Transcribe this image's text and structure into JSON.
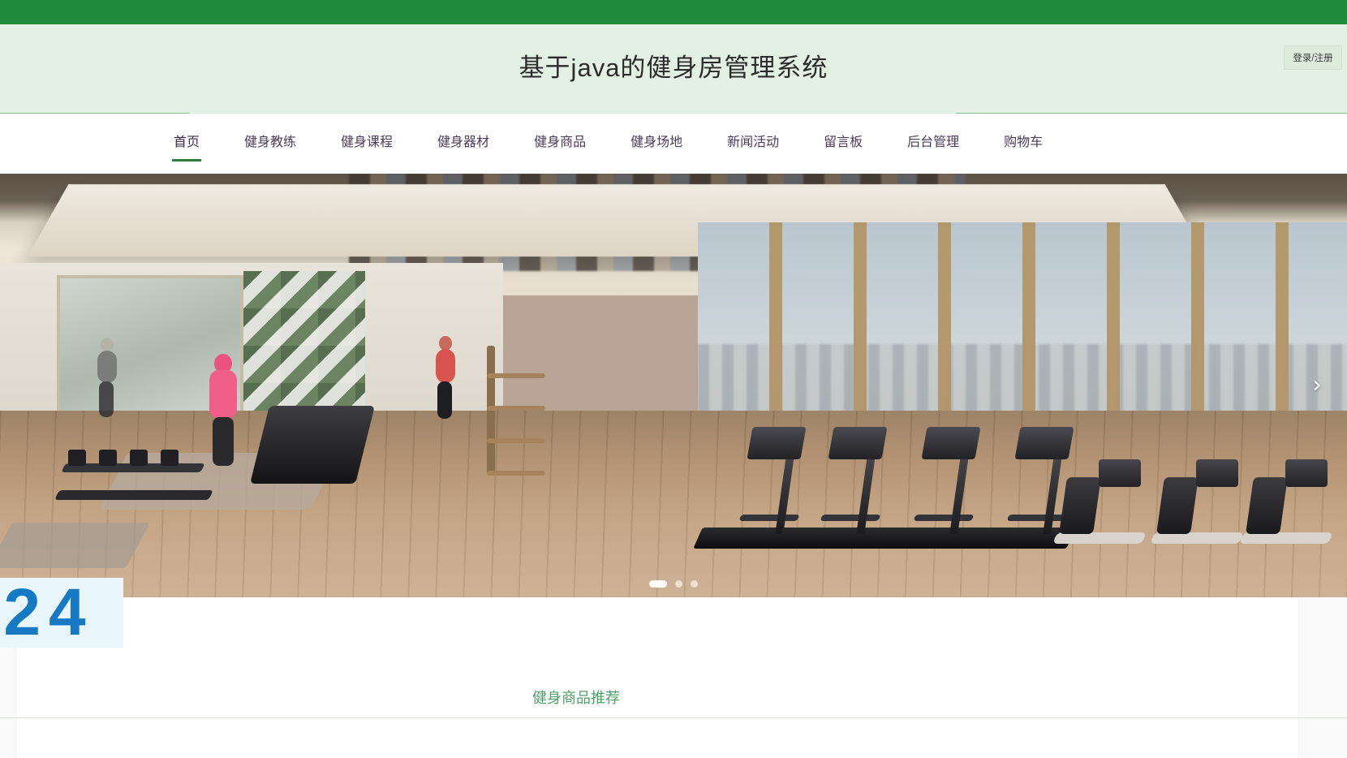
{
  "site": {
    "title": "基于java的健身房管理系统",
    "accent_green": "#1f8a3b",
    "header_bg": "#e3f0e4",
    "nav_text_color": "#4b3a5a",
    "section_title_color": "#4fa06a"
  },
  "header": {
    "login_label": "登录/注册"
  },
  "nav": {
    "items": [
      {
        "label": "首页",
        "active": true
      },
      {
        "label": "健身教练",
        "active": false
      },
      {
        "label": "健身课程",
        "active": false
      },
      {
        "label": "健身器材",
        "active": false
      },
      {
        "label": "健身商品",
        "active": false
      },
      {
        "label": "健身场地",
        "active": false
      },
      {
        "label": "新闻活动",
        "active": false
      },
      {
        "label": "留言板",
        "active": false
      },
      {
        "label": "后台管理",
        "active": false
      },
      {
        "label": "购物车",
        "active": false
      }
    ]
  },
  "carousel": {
    "next_arrow_glyph": "›",
    "dots": [
      {
        "active": true
      },
      {
        "active": false
      },
      {
        "active": false
      }
    ],
    "slide_alt": "健身房室内全景"
  },
  "watermark": {
    "text": "24"
  },
  "section": {
    "title": "健身商品推荐"
  }
}
